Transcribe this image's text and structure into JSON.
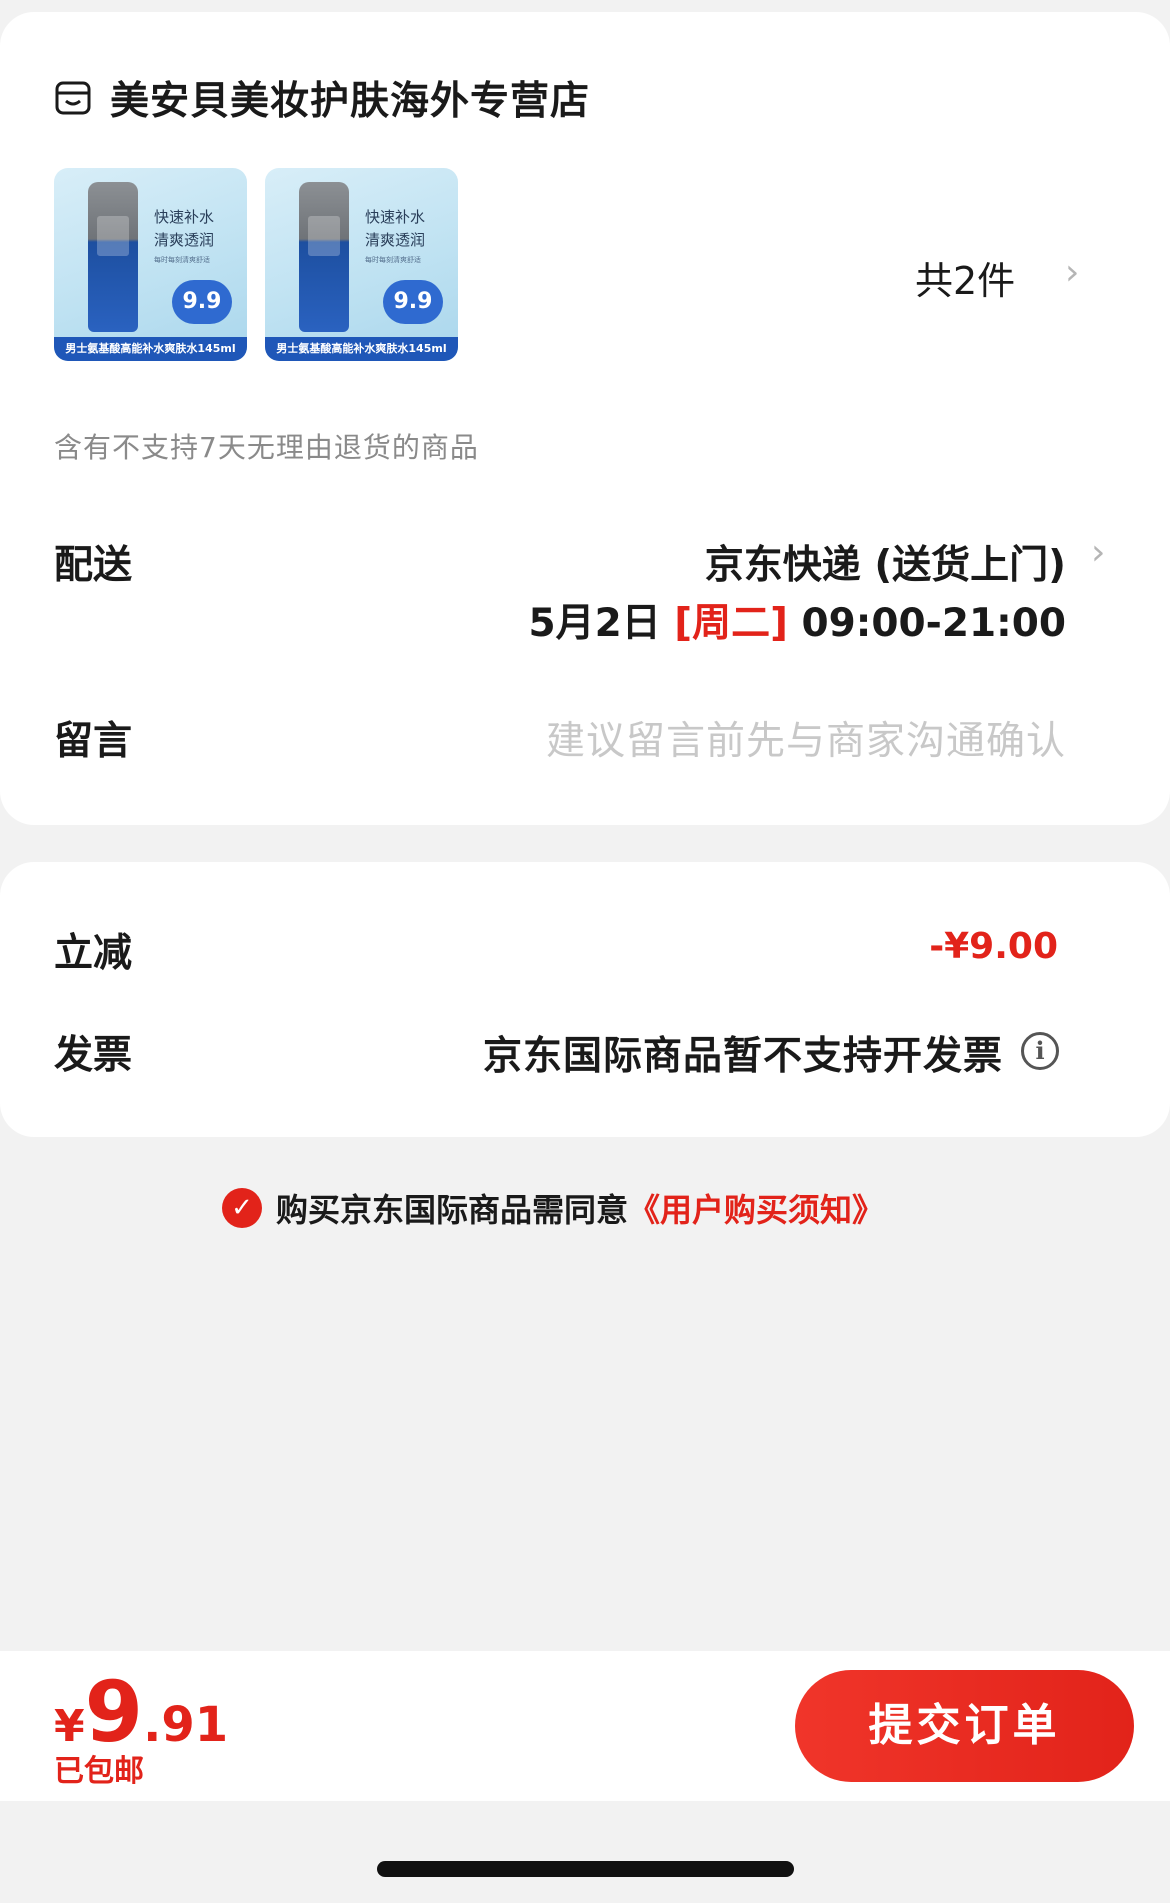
{
  "shop": {
    "name": "美安貝美妆护肤海外专营店",
    "icon": "shop-icon"
  },
  "products": [
    {
      "title_line1": "快速补水",
      "title_line2": "清爽透润",
      "small": "每时每刻清爽舒适",
      "badge": "9.9",
      "caption": "男士氨基酸高能补水爽肤水145ml"
    },
    {
      "title_line1": "快速补水",
      "title_line2": "清爽透润",
      "small": "每时每刻清爽舒适",
      "badge": "9.9",
      "caption": "男士氨基酸高能补水爽肤水145ml"
    }
  ],
  "order": {
    "total_count": "共2件"
  },
  "notice": "含有不支持7天无理由退货的商品",
  "delivery": {
    "label": "配送",
    "method": "京东快递 (送货上门)",
    "date": "5月2日",
    "weekday": "[周二]",
    "time": "09:00-21:00"
  },
  "message": {
    "label": "留言",
    "placeholder": "建议留言前先与商家沟通确认"
  },
  "discount": {
    "label": "立减",
    "value": "-¥9.00"
  },
  "invoice": {
    "label": "发票",
    "value": "京东国际商品暂不支持开发票"
  },
  "agreement": {
    "text": "购买京东国际商品需同意",
    "link": "《用户购买须知》",
    "checked": true
  },
  "footer": {
    "currency": "¥",
    "price_int": "9",
    "price_dec": ".91",
    "shipping": "已包邮",
    "submit_label": "提交订单"
  },
  "colors": {
    "accent": "#e2231a",
    "background": "#f2f2f2",
    "card": "#ffffff",
    "muted": "#8a8a8a",
    "placeholder": "#c8c8c8"
  }
}
